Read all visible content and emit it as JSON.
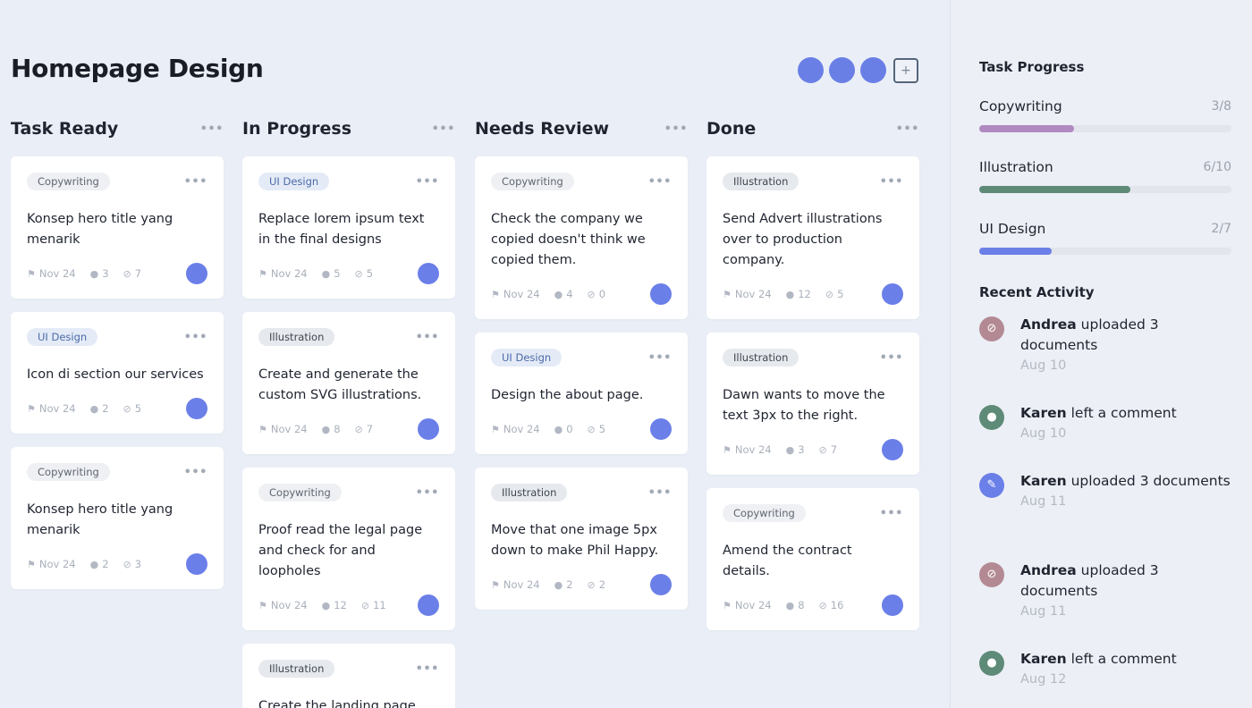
{
  "page_title": "Homepage Design",
  "members": [
    "#6a7fe6",
    "#6a7fe6",
    "#6a7fe6"
  ],
  "add_member_label": "+",
  "accent": "#6b7fe8",
  "columns": [
    {
      "title": "Task Ready",
      "menu": "•••",
      "cards": [
        {
          "tag": "Copywriting",
          "tag_type": "copy",
          "title": "Konsep hero title yang menarik",
          "date": "Nov 24",
          "comments": "3",
          "attachments": "7"
        },
        {
          "tag": "UI Design",
          "tag_type": "ui",
          "title": "Icon di section our services",
          "date": "Nov 24",
          "comments": "2",
          "attachments": "5"
        },
        {
          "tag": "Copywriting",
          "tag_type": "copy",
          "title": "Konsep hero title yang menarik",
          "date": "Nov 24",
          "comments": "2",
          "attachments": "3"
        }
      ]
    },
    {
      "title": "In Progress",
      "menu": "•••",
      "cards": [
        {
          "tag": "UI Design",
          "tag_type": "ui",
          "title": "Replace lorem ipsum text in the final designs",
          "date": "Nov 24",
          "comments": "5",
          "attachments": "5"
        },
        {
          "tag": "Illustration",
          "tag_type": "ill",
          "title": "Create and generate the custom SVG illustrations.",
          "date": "Nov 24",
          "comments": "8",
          "attachments": "7"
        },
        {
          "tag": "Copywriting",
          "tag_type": "copy",
          "title": "Proof read the legal page and check for and loopholes",
          "date": "Nov 24",
          "comments": "12",
          "attachments": "11"
        },
        {
          "tag": "Illustration",
          "tag_type": "ill",
          "title": "Create the landing page",
          "date": "",
          "comments": "",
          "attachments": ""
        }
      ]
    },
    {
      "title": "Needs Review",
      "menu": "•••",
      "cards": [
        {
          "tag": "Copywriting",
          "tag_type": "copy",
          "title": "Check the company we copied doesn't think we copied them.",
          "date": "Nov 24",
          "comments": "4",
          "attachments": "0"
        },
        {
          "tag": "UI Design",
          "tag_type": "ui",
          "title": "Design the about page.",
          "date": "Nov 24",
          "comments": "0",
          "attachments": "5"
        },
        {
          "tag": "Illustration",
          "tag_type": "ill",
          "title": "Move that one image 5px down to make Phil Happy.",
          "date": "Nov 24",
          "comments": "2",
          "attachments": "2"
        }
      ]
    },
    {
      "title": "Done",
      "menu": "•••",
      "cards": [
        {
          "tag": "Illustration",
          "tag_type": "ill",
          "title": "Send Advert illustrations over to production company.",
          "date": "Nov 24",
          "comments": "12",
          "attachments": "5"
        },
        {
          "tag": "Illustration",
          "tag_type": "ill",
          "title": "Dawn wants to move the text 3px to the right.",
          "date": "Nov 24",
          "comments": "3",
          "attachments": "7"
        },
        {
          "tag": "Copywriting",
          "tag_type": "copy",
          "title": "Amend the contract details.",
          "date": "Nov 24",
          "comments": "8",
          "attachments": "16"
        }
      ]
    }
  ],
  "sidebar": {
    "progress_title": "Task Progress",
    "progress": [
      {
        "label": "Copywriting",
        "count": "3/8",
        "fraction": 0.375,
        "color": "#b189c1"
      },
      {
        "label": "Illustration",
        "count": "6/10",
        "fraction": 0.6,
        "color": "#5e8a78"
      },
      {
        "label": "UI Design",
        "count": "2/7",
        "fraction": 0.286,
        "color": "#6b7fe8"
      }
    ],
    "activity_title": "Recent Activity",
    "activity": [
      {
        "user": "Andrea",
        "action": " uploaded 3 documents",
        "time": "Aug 10",
        "icon": "paperclip-icon",
        "color": "#b38a94"
      },
      {
        "user": "Karen",
        "action": " left a comment",
        "time": "Aug 10",
        "icon": "comment-icon",
        "color": "#5e8a78"
      },
      {
        "user": "Karen",
        "action": " uploaded 3 documents",
        "time": "Aug 11",
        "icon": "pencil-icon",
        "color": "#6b7fe8"
      },
      {
        "user": "Andrea",
        "action": " uploaded 3 documents",
        "time": "Aug 11",
        "icon": "paperclip-icon",
        "color": "#b38a94"
      },
      {
        "user": "Karen",
        "action": " left a comment",
        "time": "Aug 12",
        "icon": "comment-icon",
        "color": "#5e8a78"
      }
    ]
  }
}
